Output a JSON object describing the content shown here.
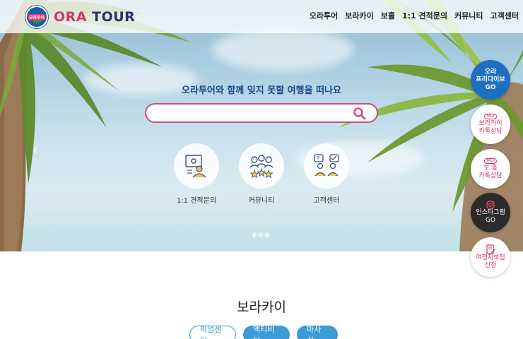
{
  "brand": {
    "logo_small": "오라투어",
    "name_part1": "ORA",
    "name_part2": "TOUR"
  },
  "nav": [
    {
      "label": "오라투어"
    },
    {
      "label": "보라카이"
    },
    {
      "label": "보홀"
    },
    {
      "label": "1:1 견적문의"
    },
    {
      "label": "커뮤니티"
    },
    {
      "label": "고객센터"
    }
  ],
  "hero": {
    "tagline": "오라투어와 함께 잊지 못할 여행을 떠나요",
    "search": {
      "placeholder": "",
      "value": "",
      "icon": "search-icon"
    },
    "quick_links": [
      {
        "label": "1:1 견적문의",
        "icon": "consultation-icon"
      },
      {
        "label": "커뮤니티",
        "icon": "community-icon"
      },
      {
        "label": "고객센터",
        "icon": "customer-center-icon"
      }
    ],
    "slide_count": 3,
    "active_slide": 1
  },
  "side_buttons": {
    "free": {
      "line1": "오라",
      "line2": "프리다이브",
      "line3": "GO"
    },
    "bora": {
      "badge": "TALK",
      "line1": "보라카이",
      "line2": "카톡상담"
    },
    "bohol": {
      "badge": "TALK",
      "line1": "보 홀",
      "line2": "카톡상담"
    },
    "insta": {
      "line1": "인스타그램",
      "line2": "GO"
    },
    "insurance": {
      "line1": "여행자보험",
      "line2": "신청"
    }
  },
  "section": {
    "title": "보라카이",
    "chips": [
      {
        "label": "픽업센딩",
        "state": "outline"
      },
      {
        "label": "액티비티",
        "state": "filled"
      },
      {
        "label": "마사지",
        "state": "filled"
      }
    ]
  },
  "colors": {
    "brand_pink": "#d9336b",
    "brand_navy": "#2a2a6e",
    "accent_blue": "#3a9bd6",
    "free_blue": "#1f6fc0"
  }
}
